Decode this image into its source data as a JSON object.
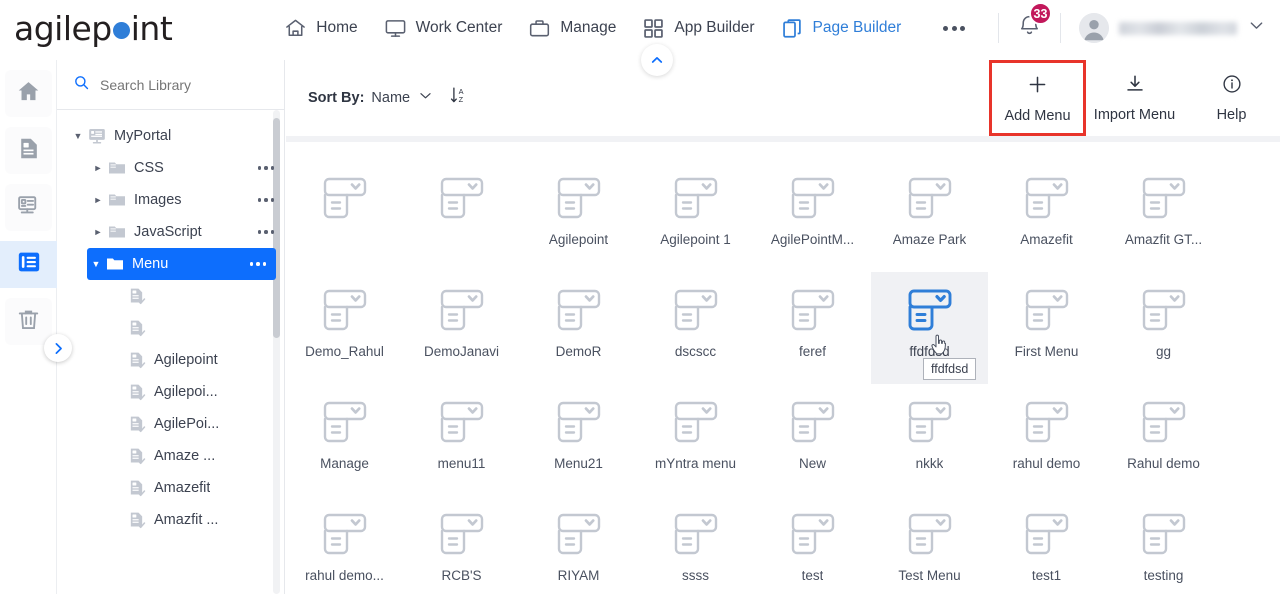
{
  "header": {
    "logo_text_1": "agilep",
    "logo_text_2": "int",
    "logo_dot_color": "#2f7ed8",
    "nav": [
      {
        "label": "Home",
        "icon": "home-icon",
        "active": false
      },
      {
        "label": "Work Center",
        "icon": "monitor-icon",
        "active": false
      },
      {
        "label": "Manage",
        "icon": "briefcase-icon",
        "active": false
      },
      {
        "label": "App Builder",
        "icon": "grid-squares-icon",
        "active": false
      },
      {
        "label": "Page Builder",
        "icon": "pages-icon",
        "active": true
      }
    ],
    "overflow_icon": "ellipsis-icon",
    "notifications": {
      "icon": "bell-icon",
      "count": "33",
      "badge_color": "#c2185b"
    },
    "user": {
      "name": "",
      "icon": "avatar-icon",
      "chevron": "chevron-down-icon"
    }
  },
  "rail": {
    "items": [
      {
        "icon": "home-icon",
        "name": "home",
        "active": false
      },
      {
        "icon": "page-icon",
        "name": "pages",
        "active": false
      },
      {
        "icon": "sitemap-icon",
        "name": "sitemap",
        "active": false
      },
      {
        "icon": "menu-list-icon",
        "name": "menu",
        "active": true
      },
      {
        "icon": "trash-icon",
        "name": "recycle-bin",
        "active": false
      }
    ],
    "expand_handle_icon": "chevron-right-icon"
  },
  "library": {
    "search": {
      "placeholder": "Search Library",
      "value": "",
      "icon": "search-icon"
    },
    "tree": [
      {
        "label": "MyPortal",
        "icon": "portal-icon",
        "caret": "▼",
        "depth": 0,
        "selected": false,
        "dots": false
      },
      {
        "label": "CSS",
        "icon": "folder-icon",
        "caret": "►",
        "depth": 1,
        "selected": false,
        "dots": true
      },
      {
        "label": "Images",
        "icon": "folder-icon",
        "caret": "►",
        "depth": 1,
        "selected": false,
        "dots": true
      },
      {
        "label": "JavaScript",
        "icon": "folder-icon",
        "caret": "►",
        "depth": 1,
        "selected": false,
        "dots": true
      },
      {
        "label": "Menu",
        "icon": "folder-icon",
        "caret": "▼",
        "depth": 1,
        "selected": true,
        "dots": true
      },
      {
        "label": "",
        "icon": "menu-check-icon",
        "caret": "",
        "depth": 2,
        "selected": false,
        "dots": false
      },
      {
        "label": "",
        "icon": "menu-check-icon",
        "caret": "",
        "depth": 2,
        "selected": false,
        "dots": false
      },
      {
        "label": "Agilepoint",
        "icon": "menu-check-icon",
        "caret": "",
        "depth": 2,
        "selected": false,
        "dots": false
      },
      {
        "label": "Agilepoi...",
        "icon": "menu-check-icon",
        "caret": "",
        "depth": 2,
        "selected": false,
        "dots": false
      },
      {
        "label": "AgilePoi...",
        "icon": "menu-check-icon",
        "caret": "",
        "depth": 2,
        "selected": false,
        "dots": false
      },
      {
        "label": "Amaze ...",
        "icon": "menu-check-icon",
        "caret": "",
        "depth": 2,
        "selected": false,
        "dots": false
      },
      {
        "label": "Amazefit",
        "icon": "menu-check-icon",
        "caret": "",
        "depth": 2,
        "selected": false,
        "dots": false
      },
      {
        "label": "Amazfit ...",
        "icon": "menu-check-icon",
        "caret": "",
        "depth": 2,
        "selected": false,
        "dots": false
      }
    ]
  },
  "toolbar": {
    "sort_by_label": "Sort By:",
    "sort_by_value": "Name",
    "sort_chevron_icon": "chevron-down-icon",
    "sort_direction_icon": "sort-az-icon",
    "collapse_icon": "chevron-up-icon",
    "actions": [
      {
        "label": "Add Menu",
        "icon": "plus-icon",
        "highlighted": true
      },
      {
        "label": "Import Menu",
        "icon": "download-icon",
        "highlighted": false
      },
      {
        "label": "Help",
        "icon": "info-icon",
        "highlighted": false
      }
    ],
    "highlight_color": "#e8342a"
  },
  "grid": {
    "item_icon": "menu-item-icon",
    "hover_color": "#2f7ed8",
    "tooltip": {
      "text": "ffdfdsd",
      "for_item": "ffdfdsd"
    },
    "cursor_icon": "pointer-cursor-icon",
    "items": [
      {
        "label": "",
        "hover": false
      },
      {
        "label": "",
        "hover": false
      },
      {
        "label": "Agilepoint",
        "hover": false
      },
      {
        "label": "Agilepoint 1",
        "hover": false
      },
      {
        "label": "AgilePointM...",
        "hover": false
      },
      {
        "label": "Amaze Park",
        "hover": false
      },
      {
        "label": "Amazefit",
        "hover": false
      },
      {
        "label": "Amazfit GT...",
        "hover": false
      },
      {
        "label": "Demo_Rahul",
        "hover": false
      },
      {
        "label": "DemoJanavi",
        "hover": false
      },
      {
        "label": "DemoR",
        "hover": false
      },
      {
        "label": "dscscc",
        "hover": false
      },
      {
        "label": "feref",
        "hover": false
      },
      {
        "label": "ffdfdsd",
        "hover": true
      },
      {
        "label": "First Menu",
        "hover": false
      },
      {
        "label": "gg",
        "hover": false
      },
      {
        "label": "Manage",
        "hover": false
      },
      {
        "label": "menu11",
        "hover": false
      },
      {
        "label": "Menu21",
        "hover": false
      },
      {
        "label": "mYntra menu",
        "hover": false
      },
      {
        "label": "New",
        "hover": false
      },
      {
        "label": "nkkk",
        "hover": false
      },
      {
        "label": "rahul demo",
        "hover": false
      },
      {
        "label": "Rahul demo",
        "hover": false
      },
      {
        "label": "rahul demo...",
        "hover": false
      },
      {
        "label": "RCB'S",
        "hover": false
      },
      {
        "label": "RIYAM",
        "hover": false
      },
      {
        "label": "ssss",
        "hover": false
      },
      {
        "label": "test",
        "hover": false
      },
      {
        "label": "Test Menu",
        "hover": false
      },
      {
        "label": "test1",
        "hover": false
      },
      {
        "label": "testing",
        "hover": false
      }
    ]
  }
}
